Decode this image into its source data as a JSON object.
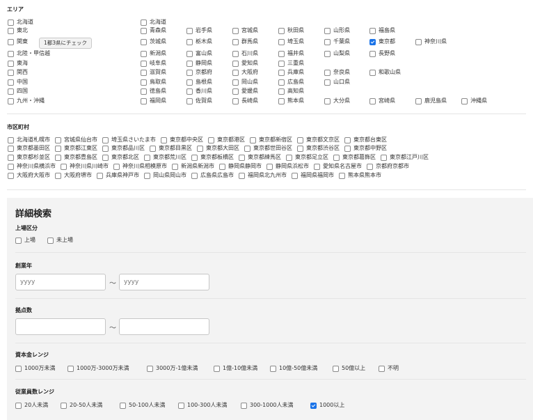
{
  "area": {
    "title": "エリア",
    "regions": [
      {
        "label": "北海道",
        "checked": false
      },
      {
        "label": "東北",
        "checked": false
      },
      {
        "label": "関東",
        "checked": false
      },
      {
        "label": "北陸・甲信越",
        "checked": false
      },
      {
        "label": "東海",
        "checked": false
      },
      {
        "label": "関西",
        "checked": false
      },
      {
        "label": "中国",
        "checked": false
      },
      {
        "label": "四国",
        "checked": false
      },
      {
        "label": "九州・沖縄",
        "checked": false
      }
    ],
    "kanto_button": "1都3県にチェック",
    "prefecture_rows": [
      [
        {
          "label": "北海道",
          "checked": false
        }
      ],
      [
        {
          "label": "青森県",
          "checked": false
        },
        {
          "label": "岩手県",
          "checked": false
        },
        {
          "label": "宮城県",
          "checked": false
        },
        {
          "label": "秋田県",
          "checked": false
        },
        {
          "label": "山形県",
          "checked": false
        },
        {
          "label": "福島県",
          "checked": false
        }
      ],
      [
        {
          "label": "茨城県",
          "checked": false
        },
        {
          "label": "栃木県",
          "checked": false
        },
        {
          "label": "群馬県",
          "checked": false
        },
        {
          "label": "埼玉県",
          "checked": false
        },
        {
          "label": "千葉県",
          "checked": false
        },
        {
          "label": "東京都",
          "checked": true
        },
        {
          "label": "神奈川県",
          "checked": false
        }
      ],
      [
        {
          "label": "新潟県",
          "checked": false
        },
        {
          "label": "富山県",
          "checked": false
        },
        {
          "label": "石川県",
          "checked": false
        },
        {
          "label": "福井県",
          "checked": false
        },
        {
          "label": "山梨県",
          "checked": false
        },
        {
          "label": "長野県",
          "checked": false
        }
      ],
      [
        {
          "label": "岐阜県",
          "checked": false
        },
        {
          "label": "静岡県",
          "checked": false
        },
        {
          "label": "愛知県",
          "checked": false
        },
        {
          "label": "三重県",
          "checked": false
        }
      ],
      [
        {
          "label": "滋賀県",
          "checked": false
        },
        {
          "label": "京都府",
          "checked": false
        },
        {
          "label": "大阪府",
          "checked": false
        },
        {
          "label": "兵庫県",
          "checked": false
        },
        {
          "label": "奈良県",
          "checked": false
        },
        {
          "label": "和歌山県",
          "checked": false
        }
      ],
      [
        {
          "label": "鳥取県",
          "checked": false
        },
        {
          "label": "島根県",
          "checked": false
        },
        {
          "label": "岡山県",
          "checked": false
        },
        {
          "label": "広島県",
          "checked": false
        },
        {
          "label": "山口県",
          "checked": false
        }
      ],
      [
        {
          "label": "徳島県",
          "checked": false
        },
        {
          "label": "香川県",
          "checked": false
        },
        {
          "label": "愛媛県",
          "checked": false
        },
        {
          "label": "高知県",
          "checked": false
        }
      ],
      [
        {
          "label": "福岡県",
          "checked": false
        },
        {
          "label": "佐賀県",
          "checked": false
        },
        {
          "label": "長崎県",
          "checked": false
        },
        {
          "label": "熊本県",
          "checked": false
        },
        {
          "label": "大分県",
          "checked": false
        },
        {
          "label": "宮崎県",
          "checked": false
        },
        {
          "label": "鹿児島県",
          "checked": false
        },
        {
          "label": "沖縄県",
          "checked": false
        }
      ]
    ]
  },
  "cities": {
    "title": "市区町村",
    "rows": [
      [
        "北海道札幌市",
        "宮城県仙台市",
        "埼玉県さいたま市",
        "東京都中央区",
        "東京都港区",
        "東京都新宿区",
        "東京都文京区",
        "東京都台東区"
      ],
      [
        "東京都墨田区",
        "東京都江東区",
        "東京都品川区",
        "東京都目黒区",
        "東京都大田区",
        "東京都世田谷区",
        "東京都渋谷区",
        "東京都中野区"
      ],
      [
        "東京都杉並区",
        "東京都豊島区",
        "東京都北区",
        "東京都荒川区",
        "東京都板橋区",
        "東京都練馬区",
        "東京都足立区",
        "東京都葛飾区",
        "東京都江戸川区"
      ],
      [
        "神奈川県横浜市",
        "神奈川県川崎市",
        "神奈川県相模原市",
        "新潟県新潟市",
        "静岡県静岡市",
        "静岡県浜松市",
        "愛知県名古屋市",
        "京都府京都市"
      ],
      [
        "大阪府大阪市",
        "大阪府堺市",
        "兵庫県神戸市",
        "岡山県岡山市",
        "広島県広島市",
        "福岡県北九州市",
        "福岡県福岡市",
        "熊本県熊本市"
      ]
    ]
  },
  "detail": {
    "title": "詳細検索",
    "listing": {
      "title": "上場区分",
      "options": [
        {
          "label": "上場",
          "checked": false
        },
        {
          "label": "未上場",
          "checked": false
        }
      ]
    },
    "founded": {
      "title": "創業年",
      "from_placeholder": "yyyy",
      "to_placeholder": "yyyy",
      "separator": "〜"
    },
    "bases": {
      "title": "拠点数",
      "from_value": "",
      "to_value": "",
      "separator": "〜"
    },
    "capital": {
      "title": "資本金レンジ",
      "options": [
        {
          "label": "1000万未満",
          "checked": false
        },
        {
          "label": "1000万-3000万未満",
          "checked": false
        },
        {
          "label": "3000万-1億未満",
          "checked": false
        },
        {
          "label": "1億-10億未満",
          "checked": false
        },
        {
          "label": "10億-50億未満",
          "checked": false
        },
        {
          "label": "50億以上",
          "checked": false
        },
        {
          "label": "不明",
          "checked": false
        }
      ]
    },
    "employees": {
      "title": "従業員数レンジ",
      "options": [
        {
          "label": "20人未満",
          "checked": false
        },
        {
          "label": "20-50人未満",
          "checked": false
        },
        {
          "label": "50-100人未満",
          "checked": false
        },
        {
          "label": "100-300人未満",
          "checked": false
        },
        {
          "label": "300-1000人未満",
          "checked": false
        },
        {
          "label": "1000以上",
          "checked": true
        }
      ]
    }
  },
  "colors": {
    "accent": "#1a73e8",
    "panel_bg": "#f3f3f3",
    "divider": "#e4e4e4"
  }
}
